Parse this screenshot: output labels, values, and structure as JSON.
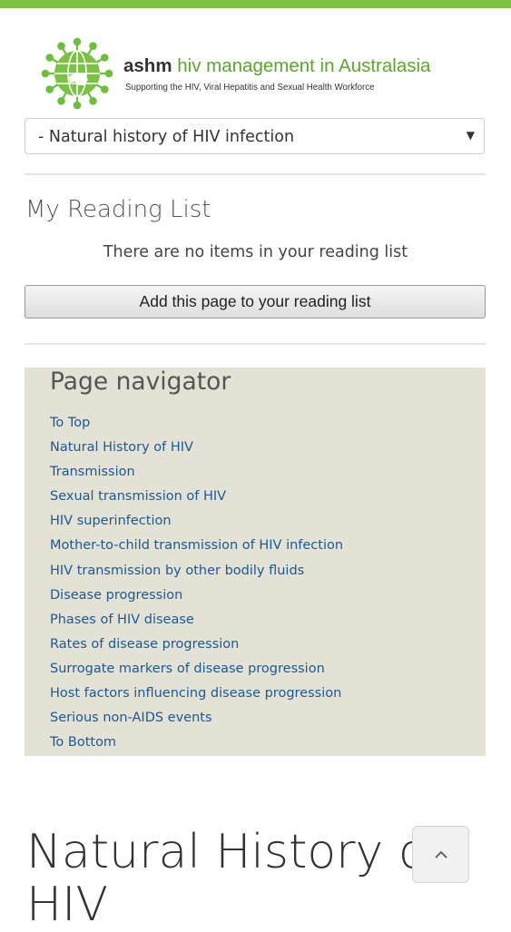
{
  "header": {
    "brand": "ashm",
    "brand_rest": " hiv management in Australasia",
    "tagline": "Supporting the HIV, Viral Hepatitis and Sexual Health Workforce",
    "accent_color": "#7cc242",
    "logo_icon": "globe-virus-icon"
  },
  "section_select": {
    "selected": "- Natural history of HIV infection",
    "arrow_icon": "caret-down-icon"
  },
  "reading_list": {
    "title": "My Reading List",
    "empty_text": "There are no items in your reading list",
    "add_button": "Add this page to your reading list"
  },
  "page_navigator": {
    "title": "Page navigator",
    "links": [
      "To Top",
      "Natural History of HIV",
      "Transmission",
      "Sexual transmission of HIV",
      "HIV superinfection",
      "Mother-to-child transmission of HIV infection",
      "HIV transmission by other bodily fluids",
      "Disease progression",
      "Phases of HIV disease",
      "Rates of disease progression",
      "Surrogate markers of disease progression",
      "Host factors influencing disease progression",
      "Serious non-AIDS events",
      "To Bottom"
    ]
  },
  "main": {
    "heading_line1": "Natural History of",
    "heading_line2": "HIV",
    "scroll_top_icon": "chevron-up-icon"
  }
}
